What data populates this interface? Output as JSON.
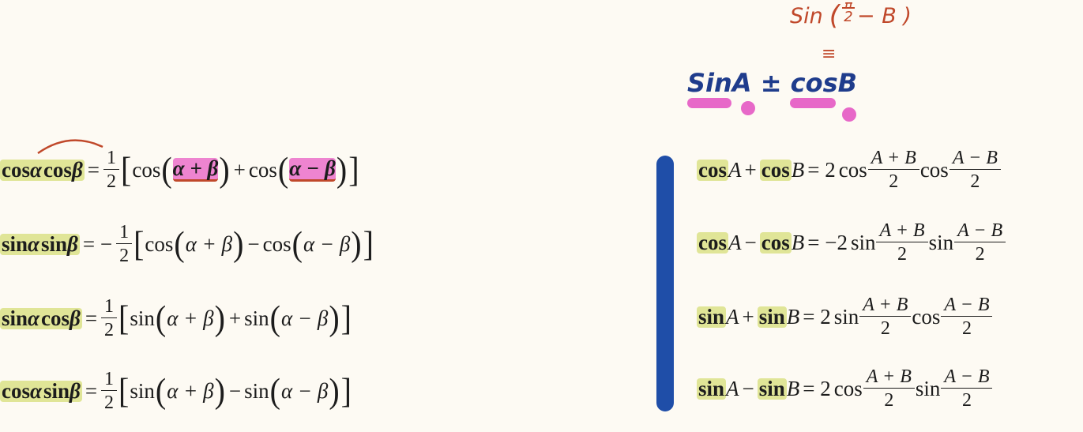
{
  "left": {
    "eq1": {
      "lhs_a": "cos",
      "lhs_b": "α",
      "lhs_c": "cos",
      "lhs_d": "β",
      "eq": "=",
      "coef_num": "1",
      "coef_den": "2",
      "t1": "cos",
      "a1": "α + β",
      "plus": "+",
      "t2": "cos",
      "a2": "α − β"
    },
    "eq2": {
      "lhs_a": "sin",
      "lhs_b": "α",
      "lhs_c": "sin",
      "lhs_d": "β",
      "eq": "= −",
      "coef_num": "1",
      "coef_den": "2",
      "t1": "cos",
      "a1": "α + β",
      "minus": "−",
      "t2": "cos",
      "a2": "α − β"
    },
    "eq3": {
      "lhs_a": "sin",
      "lhs_b": "α",
      "lhs_c": "cos",
      "lhs_d": "β",
      "eq": "=",
      "coef_num": "1",
      "coef_den": "2",
      "t1": "sin",
      "a1": "α + β",
      "plus": "+",
      "t2": "sin",
      "a2": "α − β"
    },
    "eq4": {
      "lhs_a": "cos",
      "lhs_b": "α",
      "lhs_c": "sin",
      "lhs_d": "β",
      "eq": "=",
      "coef_num": "1",
      "coef_den": "2",
      "t1": "sin",
      "a1": "α + β",
      "minus": "−",
      "t2": "sin",
      "a2": "α − β"
    }
  },
  "right": {
    "eq1": {
      "f1": "cos",
      "v1": "A",
      "op": "+",
      "f2": "cos",
      "v2": "B",
      "eq": "= 2",
      "g1": "cos",
      "n1": "A + B",
      "d1": "2",
      "g2": "cos",
      "n2": "A − B",
      "d2": "2"
    },
    "eq2": {
      "f1": "cos",
      "v1": "A",
      "op": "−",
      "f2": "cos",
      "v2": "B",
      "eq": "= −2",
      "g1": "sin",
      "n1": "A + B",
      "d1": "2",
      "g2": "sin",
      "n2": "A − B",
      "d2": "2"
    },
    "eq3": {
      "f1": "sin",
      "v1": "A",
      "op": "+",
      "f2": "sin",
      "v2": "B",
      "eq": "= 2",
      "g1": "sin",
      "n1": "A + B",
      "d1": "2",
      "g2": "cos",
      "n2": "A − B",
      "d2": "2"
    },
    "eq4": {
      "f1": "sin",
      "v1": "A",
      "op": "−",
      "f2": "sin",
      "v2": "B",
      "eq": "= 2",
      "g1": "cos",
      "n1": "A + B",
      "d1": "2",
      "g2": "sin",
      "n2": "A − B",
      "d2": "2"
    }
  },
  "annotations": {
    "red_note_a": "Sin",
    "red_note_b": "(",
    "red_note_num": "π",
    "red_note_den": "2",
    "red_note_c": "− B )",
    "red_equals": "≡",
    "blue_note": "SinA ± cosB"
  },
  "colors": {
    "highlight": "#d6de78",
    "pink": "#e768c8",
    "divider": "#1f4ea8",
    "red_ink": "#c0482a",
    "blue_ink": "#1f3c8c"
  }
}
